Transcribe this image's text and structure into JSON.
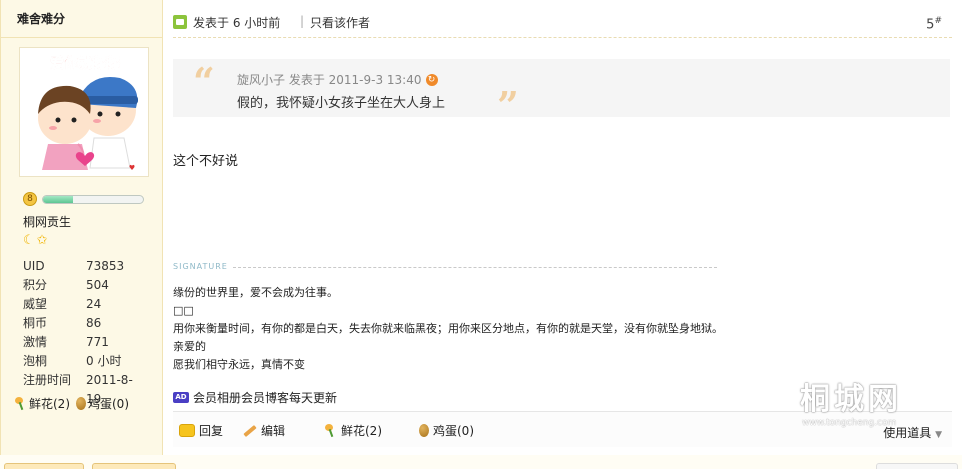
{
  "user": {
    "name": "难舍难分",
    "rank_medal": "8",
    "title": "桐网贡生",
    "level_progress": 0.3,
    "stats": [
      {
        "key": "UID",
        "value": "73853"
      },
      {
        "key": "积分",
        "value": "504"
      },
      {
        "key": "威望",
        "value": "24"
      },
      {
        "key": "桐币",
        "value": "86"
      },
      {
        "key": "激情",
        "value": "771"
      },
      {
        "key": "泡桐",
        "value": "0 小时"
      },
      {
        "key": "注册时间",
        "value": "2011-8-19"
      }
    ],
    "flowers": "鲜花(2)",
    "eggs": "鸡蛋(0)",
    "avatar_text": "爱你就舔舔"
  },
  "post": {
    "posted": "发表于 6 小时前",
    "separator": "|",
    "only_author": "只看该作者",
    "floor": "5",
    "floor_sup": "#",
    "quote": {
      "meta": "旋风小子 发表于 2011-9-3 13:40",
      "text": "假的，我怀疑小女孩子坐在大人身上"
    },
    "content": "这个不好说",
    "signature_label": "SIGNATURE",
    "signature_lines": [
      "缘份的世界里，爱不会成为往事。",
      "□□",
      "用你来衡量时间，有你的都是白天，失去你就来临黑夜；用你来区分地点，有你的就是天堂，没有你就坠身地狱。",
      "亲爱的",
      "愿我们相守永远，真情不变"
    ],
    "ad_icon": "AD",
    "ad_text": "会员相册会员博客每天更新"
  },
  "actions": {
    "reply": "回复",
    "edit": "编辑",
    "flowers": "鲜花(2)",
    "eggs": "鸡蛋(0)",
    "use_tools": "使用道具"
  },
  "watermark": {
    "title": "桐城网",
    "url": "www.tongcheng.com"
  }
}
